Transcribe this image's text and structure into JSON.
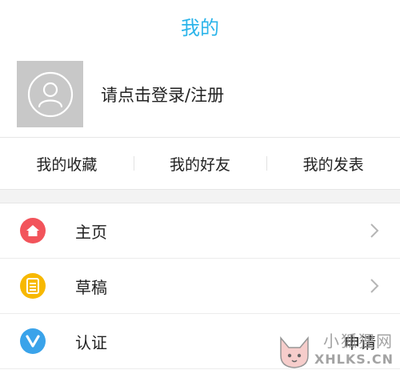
{
  "header": {
    "title": "我的"
  },
  "profile": {
    "login_text": "请点击登录/注册"
  },
  "shortcuts": [
    {
      "label": "我的收藏"
    },
    {
      "label": "我的好友"
    },
    {
      "label": "我的发表"
    }
  ],
  "menu": [
    {
      "label": "主页",
      "icon": "home-icon",
      "color": "#f2545b"
    },
    {
      "label": "草稿",
      "icon": "notepad-icon",
      "color": "#f7b800"
    },
    {
      "label": "认证",
      "icon": "verified-v-icon",
      "color": "#3aa3ea",
      "value": "申请"
    }
  ],
  "watermark": {
    "text_cn": "小狐狸网",
    "text_en": "XHLKS.CN"
  },
  "colors": {
    "accent": "#2bb4ea",
    "avatar_bg": "#c8c8c8",
    "divider": "#e6e6e6"
  }
}
